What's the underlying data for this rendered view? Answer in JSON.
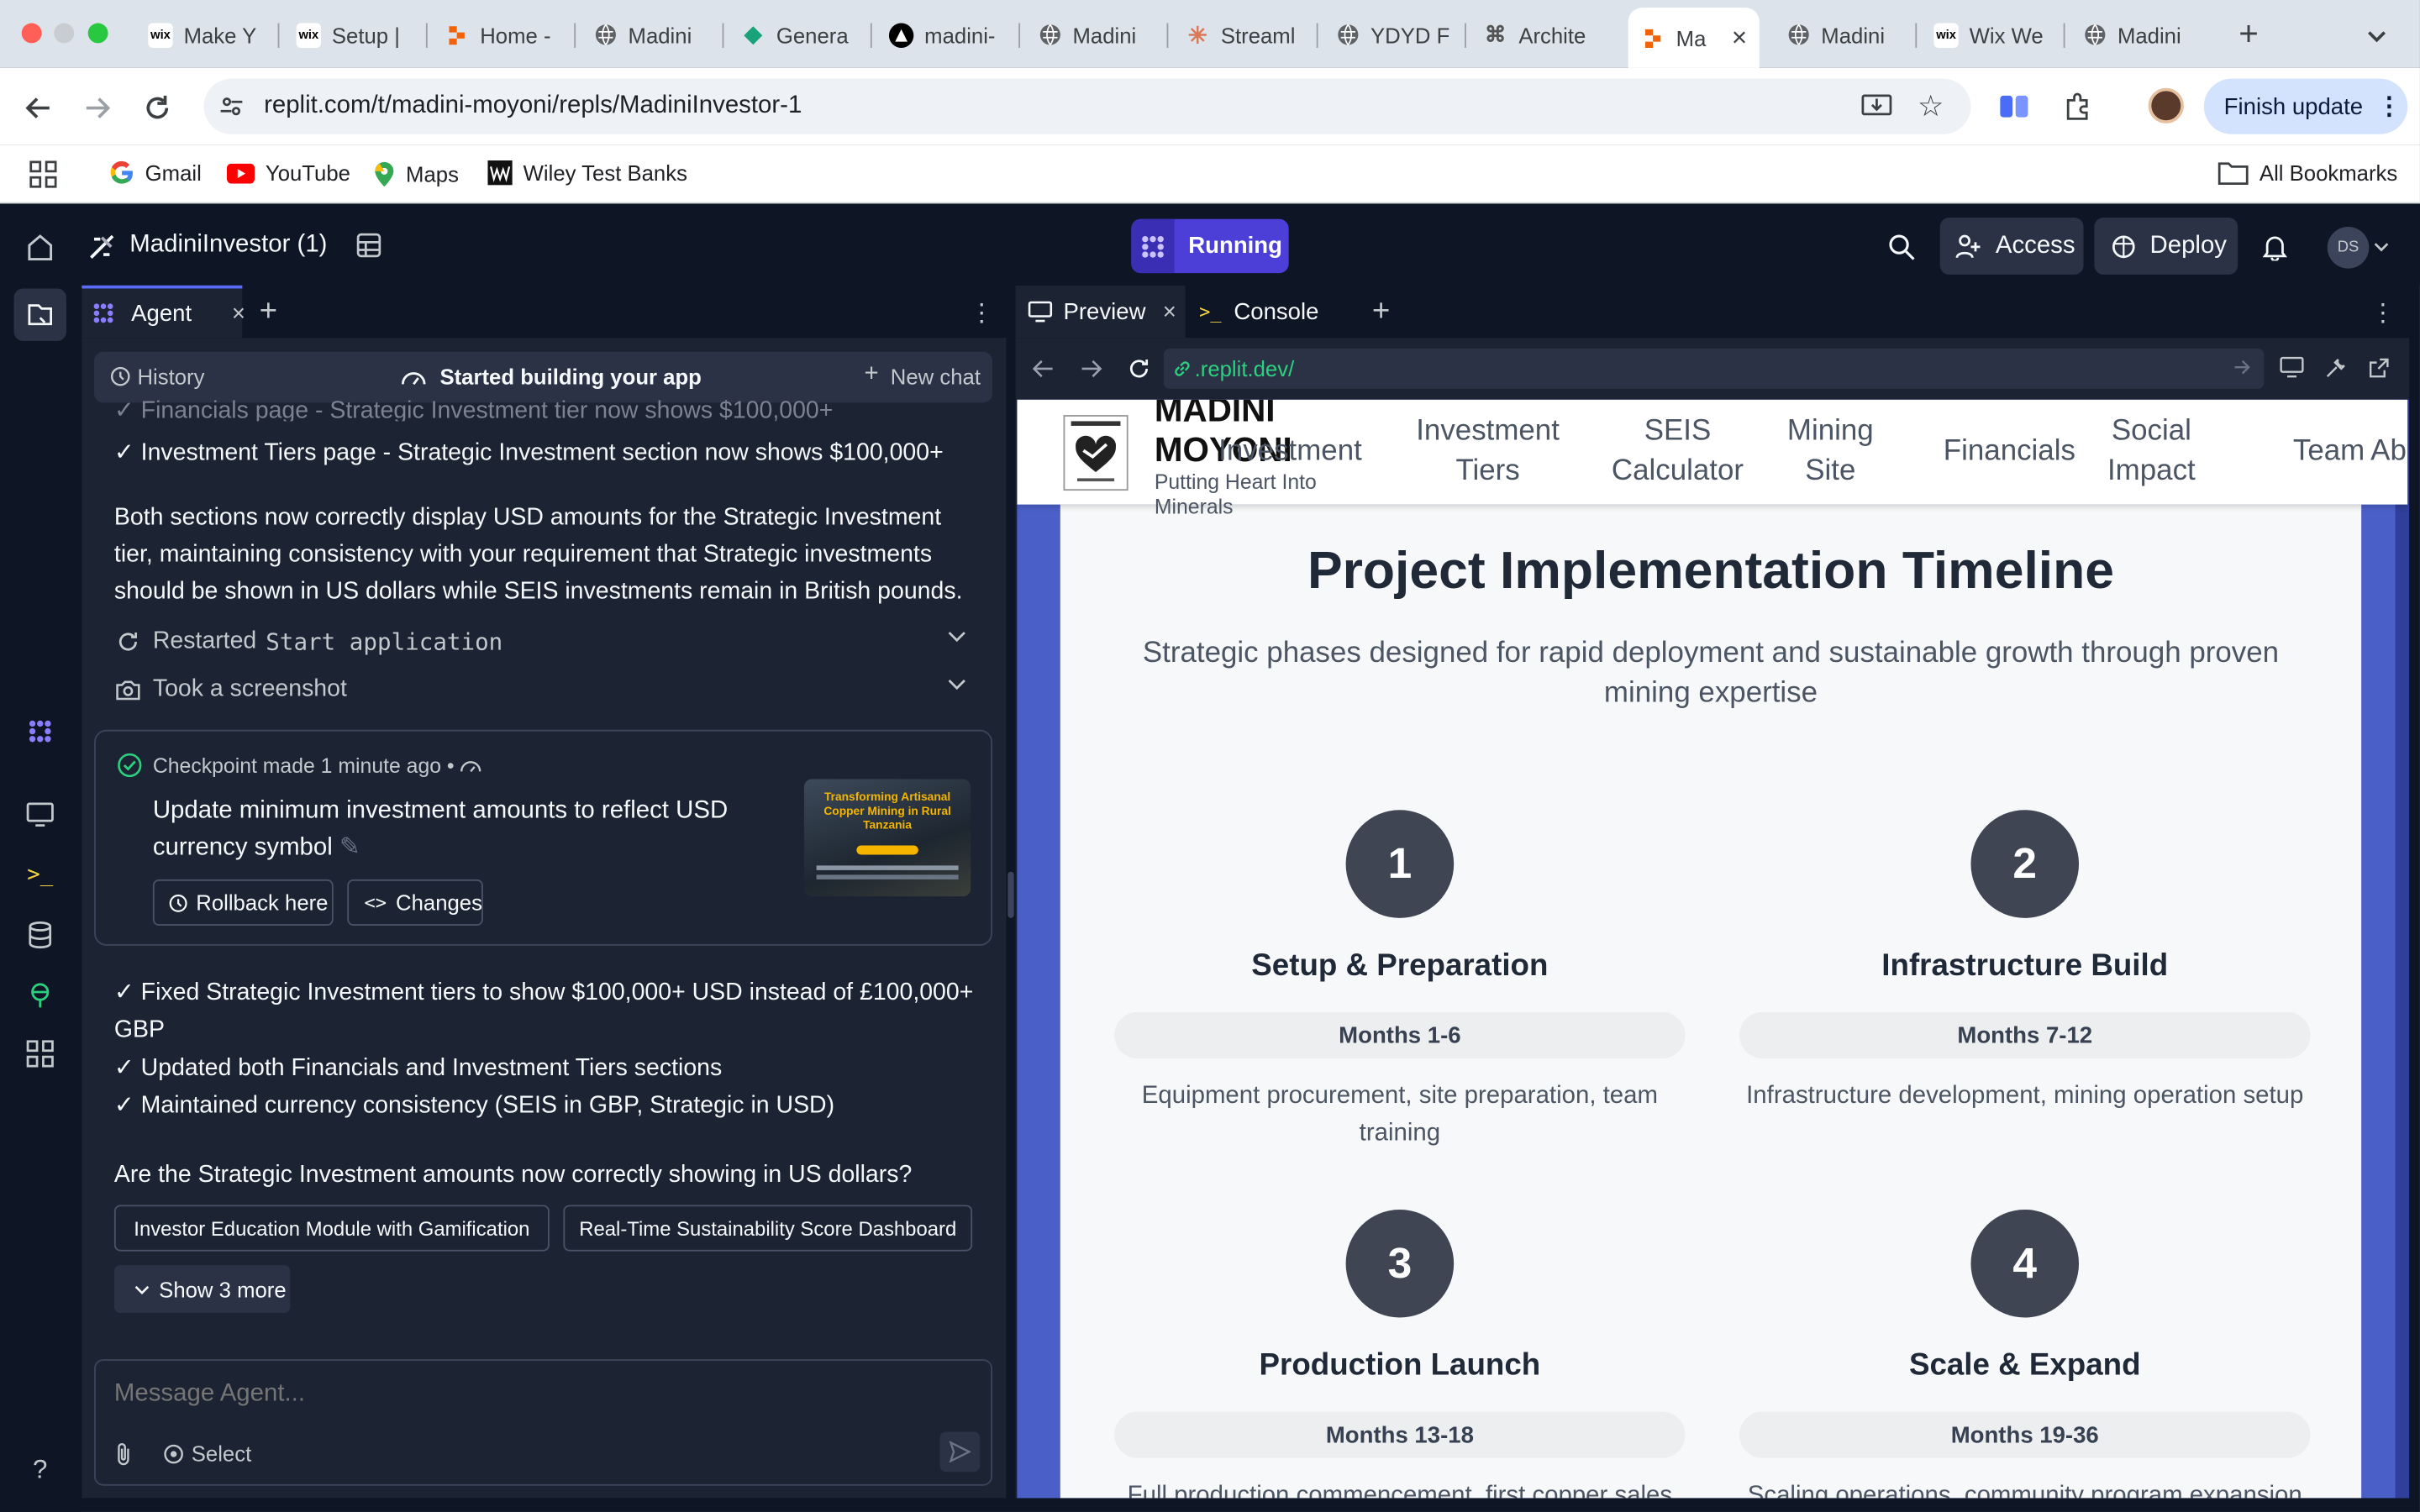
{
  "browser": {
    "tabs": [
      {
        "label": "Make Y",
        "favicon": "WIX",
        "favcolor": "#111"
      },
      {
        "label": "Setup |",
        "favicon": "WIX",
        "favcolor": "#111"
      },
      {
        "label": "Home -",
        "favicon": "R",
        "favcolor": "#f26207"
      },
      {
        "label": "Madini",
        "favicon": "globe-icon",
        "favcolor": "#5f6368"
      },
      {
        "label": "Genera",
        "favicon": "diamond-icon",
        "favcolor": "#1aa37a"
      },
      {
        "label": "madini-",
        "favicon": "A",
        "favcolor": "#000"
      },
      {
        "label": "Madini",
        "favicon": "globe-icon",
        "favcolor": "#5f6368"
      },
      {
        "label": "Streaml",
        "favicon": "burst-icon",
        "favcolor": "#d97757"
      },
      {
        "label": "YDYD F",
        "favicon": "globe-icon",
        "favcolor": "#5f6368"
      },
      {
        "label": "Archite",
        "favicon": "knot-icon",
        "favcolor": "#555"
      },
      {
        "label": "Ma",
        "favicon": "R",
        "favcolor": "#f26207"
      },
      {
        "label": "Madini",
        "favicon": "globe-icon",
        "favcolor": "#5f6368"
      },
      {
        "label": "Wix We",
        "favicon": "WIX",
        "favcolor": "#111"
      },
      {
        "label": "Madini",
        "favicon": "globe-icon",
        "favcolor": "#5f6368"
      }
    ],
    "url": "replit.com/t/madini-moyoni/repls/MadiniInvestor-1",
    "finish_update": "Finish update",
    "bookmarks": [
      {
        "label": "Gmail",
        "icon": "google-icon"
      },
      {
        "label": "YouTube",
        "icon": "youtube-icon"
      },
      {
        "label": "Maps",
        "icon": "maps-icon"
      },
      {
        "label": "Wiley Test Banks",
        "icon": "wiley-icon"
      }
    ],
    "all_bookmarks": "All Bookmarks"
  },
  "replit": {
    "project_name": "MadiniInvestor (1)",
    "running": "Running",
    "access": "Access",
    "deploy": "Deploy",
    "avatar": "DS"
  },
  "agent": {
    "tab_label": "Agent",
    "history": "History",
    "status": "Started building your app",
    "new_chat": "New chat",
    "line_faded": "✓ Financials page - Strategic Investment tier now shows $100,000+",
    "line1": "✓ Investment Tiers page - Strategic Investment section now shows $100,000+",
    "para1": "Both sections now correctly display USD amounts for the Strategic Investment tier, maintaining consistency with your requirement that Strategic investments should be shown in US dollars while SEIS investments remain in British pounds.",
    "restarted": "Restarted",
    "restarted_cmd": "Start application",
    "screenshot": "Took a screenshot",
    "checkpoint": "Checkpoint made 1 minute ago •",
    "checkpoint_title": "Update minimum investment amounts to reflect USD currency symbol",
    "rollback": "Rollback here",
    "changes": "Changes",
    "thumb_title": "Transforming Artisanal Copper Mining in Rural Tanzania",
    "summary": [
      "✓ Fixed Strategic Investment tiers to show $100,000+ USD instead of £100,000+ GBP",
      "✓ Updated both Financials and Investment Tiers sections",
      "✓ Maintained currency consistency (SEIS in GBP, Strategic in USD)"
    ],
    "question": "Are the Strategic Investment amounts now correctly showing in US dollars?",
    "suggestions": [
      "Investor Education Module with Gamification",
      "Real-Time Sustainability Score Dashboard"
    ],
    "show_more": "Show 3 more",
    "input_placeholder": "Message Agent...",
    "select": "Select"
  },
  "preview": {
    "tab_preview": "Preview",
    "tab_console": "Console",
    "url": ".replit.dev/"
  },
  "site": {
    "brand": "MADINI MOYONI",
    "tagline": "Putting Heart Into Minerals",
    "nav": [
      {
        "label": "Investment",
        "line2": ""
      },
      {
        "label": "Investment",
        "line2": "Tiers"
      },
      {
        "label": "SEIS",
        "line2": "Calculator"
      },
      {
        "label": "Mining",
        "line2": "Site"
      },
      {
        "label": "Financials",
        "line2": ""
      },
      {
        "label": "Social",
        "line2": "Impact"
      },
      {
        "label": "Team",
        "line2": ""
      },
      {
        "label": "Ab",
        "line2": ""
      }
    ],
    "section_title": "Project Implementation Timeline",
    "section_subtitle": "Strategic phases designed for rapid deployment and sustainable growth through proven mining expertise",
    "phases": [
      {
        "num": "1",
        "title": "Setup & Preparation",
        "months": "Months 1-6",
        "desc": "Equipment procurement, site preparation, team training"
      },
      {
        "num": "2",
        "title": "Infrastructure Build",
        "months": "Months 7-12",
        "desc": "Infrastructure development, mining operation setup"
      },
      {
        "num": "3",
        "title": "Production Launch",
        "months": "Months 13-18",
        "desc": "Full production commencement, first copper sales"
      },
      {
        "num": "4",
        "title": "Scale & Expand",
        "months": "Months 19-36",
        "desc": "Scaling operations, community program expansion"
      }
    ]
  }
}
